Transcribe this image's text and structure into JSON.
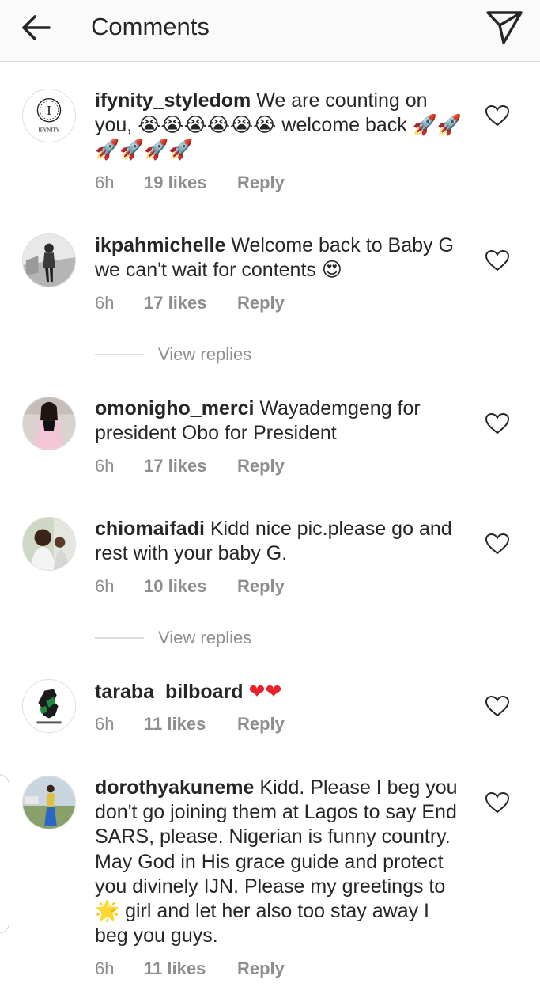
{
  "header": {
    "title": "Comments",
    "back_icon": "arrow-left-icon",
    "send_icon": "paper-plane-icon"
  },
  "comments": [
    {
      "username": "ifynity_styledom",
      "text": "We are counting on you, 😭😭😭😭😭😭 welcome back 🚀🚀🚀🚀🚀🚀",
      "time": "6h",
      "likes": "19 likes",
      "reply": "Reply",
      "avatar_text": "I",
      "avatar_caption": "IFYNITY"
    },
    {
      "username": "ikpahmichelle",
      "text": "Welcome back to Baby G we can't wait for contents 😍",
      "time": "6h",
      "likes": "17 likes",
      "reply": "Reply",
      "view_replies": "View replies"
    },
    {
      "username": "omonigho_merci",
      "text": "Wayademgeng for president  Obo for President",
      "time": "6h",
      "likes": "17 likes",
      "reply": "Reply"
    },
    {
      "username": "chiomaifadi",
      "text": "Kidd nice pic.please go and rest with your baby G.",
      "time": "6h",
      "likes": "10 likes",
      "reply": "Reply",
      "view_replies": "View replies"
    },
    {
      "username": "taraba_bilboard",
      "text": "❤❤",
      "time": "6h",
      "likes": "11 likes",
      "reply": "Reply"
    },
    {
      "username": "dorothyakuneme",
      "text": "Kidd. Please I beg you don't go joining them at Lagos to say End SARS, please. Nigerian is funny country. May God in His grace guide and protect you divinely IJN. Please my greetings to 🌟 girl and let her also too stay away I beg you guys.",
      "time": "6h",
      "likes": "11 likes",
      "reply": "Reply"
    }
  ],
  "colors": {
    "text": "#262626",
    "meta": "#8e8e8e",
    "heart_red": "#e8222b"
  }
}
